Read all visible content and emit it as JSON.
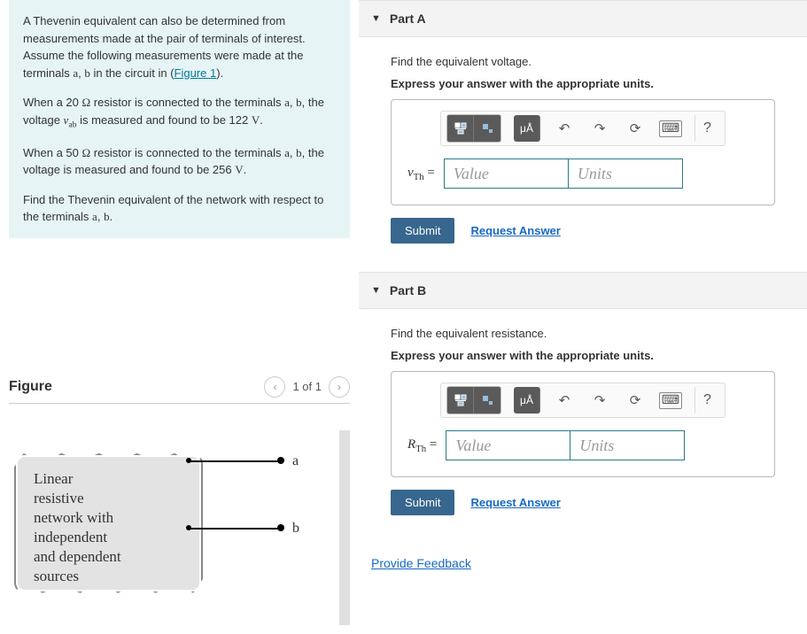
{
  "problem": {
    "p1_a": "A Thevenin equivalent can also be determined from measurements made at the pair of terminals of interest. Assume the following measurements were made at the terminals ",
    "p1_b": "a",
    "p1_c": ", ",
    "p1_d": "b",
    "p1_e": " in the circuit in (",
    "figure_link": "Figure 1",
    "p1_f": ").",
    "p2_a": "When a 20 ",
    "ohm": "Ω",
    "p2_b": " resistor is connected to the terminals ",
    "p2_c": "a",
    "p2_d": ", ",
    "p2_e": "b",
    "p2_f": ", the voltage ",
    "vab": "v",
    "vab_sub": "ab",
    "p2_g": " is measured and found to be 122 ",
    "volts": "V",
    "p2_h": ".",
    "p3_a": "When a 50 ",
    "p3_b": " resistor is connected to the terminals ",
    "p3_c": "a",
    "p3_d": ", ",
    "p3_e": "b",
    "p3_f": ", the voltage is measured and found to be 256 ",
    "p3_g": ".",
    "p4_a": "Find the Thevenin equivalent of the network with respect to the terminals ",
    "p4_b": "a",
    "p4_c": ", ",
    "p4_d": "b",
    "p4_e": "."
  },
  "figure": {
    "title": "Figure",
    "counter": "1 of 1",
    "box_l1": "Linear",
    "box_l2": "resistive",
    "box_l3": "network with",
    "box_l4": "independent",
    "box_l5": "and dependent",
    "box_l6": "sources",
    "term_a": "a",
    "term_b": "b"
  },
  "partA": {
    "header": "Part A",
    "prompt": "Find the equivalent voltage.",
    "instruct": "Express your answer with the appropriate units.",
    "var_sym": "v",
    "var_sub": "Th",
    "eq": " =",
    "value_ph": "Value",
    "units_ph": "Units",
    "submit": "Submit",
    "request": "Request Answer"
  },
  "partB": {
    "header": "Part B",
    "prompt": "Find the equivalent resistance.",
    "instruct": "Express your answer with the appropriate units.",
    "var_sym": "R",
    "var_sub": "Th",
    "eq": " =",
    "value_ph": "Value",
    "units_ph": "Units",
    "submit": "Submit",
    "request": "Request Answer"
  },
  "toolbar": {
    "units_btn": "μÅ",
    "help": "?"
  },
  "feedback": "Provide Feedback"
}
